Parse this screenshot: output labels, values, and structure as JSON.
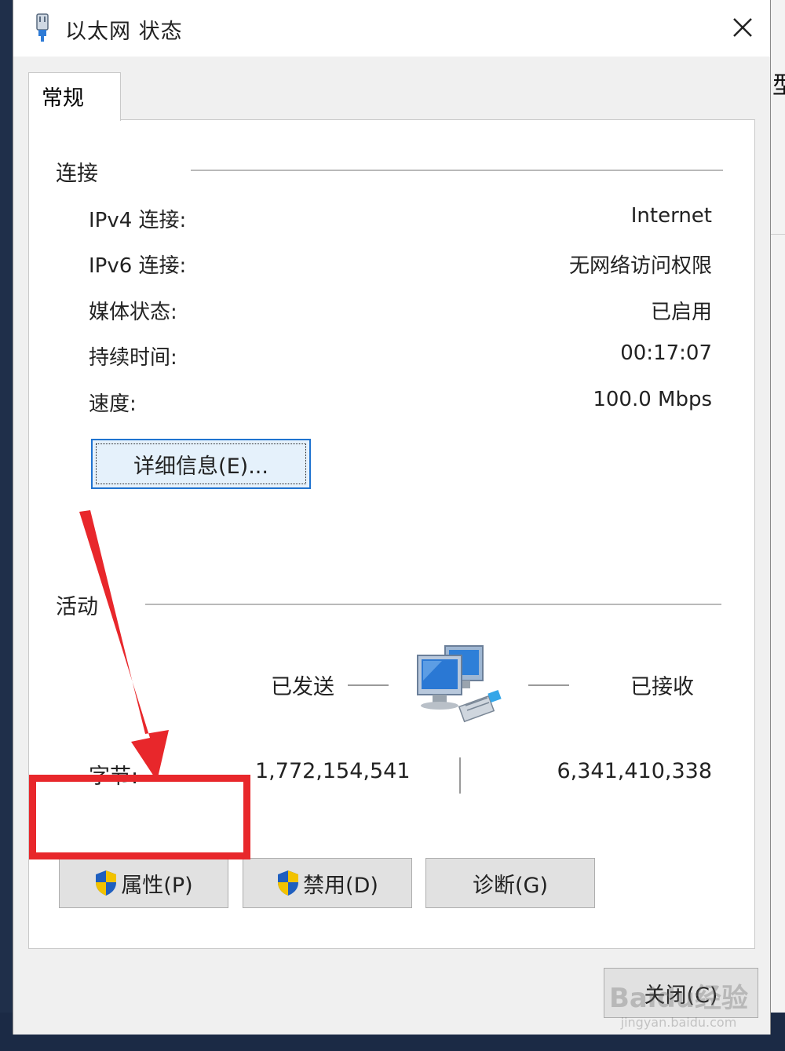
{
  "window": {
    "title": "以太网 状态",
    "tab": "常规"
  },
  "connection": {
    "group_title": "连接",
    "rows": [
      {
        "label": "IPv4 连接:",
        "value": "Internet"
      },
      {
        "label": "IPv6 连接:",
        "value": "无网络访问权限"
      },
      {
        "label": "媒体状态:",
        "value": "已启用"
      },
      {
        "label": "持续时间:",
        "value": "00:17:07"
      },
      {
        "label": "速度:",
        "value": "100.0 Mbps"
      }
    ],
    "details_button": "详细信息(E)..."
  },
  "activity": {
    "group_title": "活动",
    "sent_label": "已发送",
    "received_label": "已接收",
    "bytes_label": "字节:",
    "bytes_sent": "1,772,154,541",
    "bytes_received": "6,341,410,338"
  },
  "buttons": {
    "properties": "属性(P)",
    "disable": "禁用(D)",
    "diagnose": "诊断(G)",
    "close": "关闭(C)"
  },
  "backdrop": {
    "edge_char": "型"
  },
  "watermark": {
    "main": "Baidu经验",
    "sub": "jingyan.baidu.com"
  },
  "icons": {
    "title": "ethernet-plug-icon",
    "close": "close-icon",
    "shield": "uac-shield-icon",
    "network": "network-computers-icon"
  },
  "colors": {
    "annotation": "#e8272b",
    "focus_border": "#1f73d0",
    "shield_blue": "#1f5fbf",
    "shield_yellow": "#f2c200"
  }
}
